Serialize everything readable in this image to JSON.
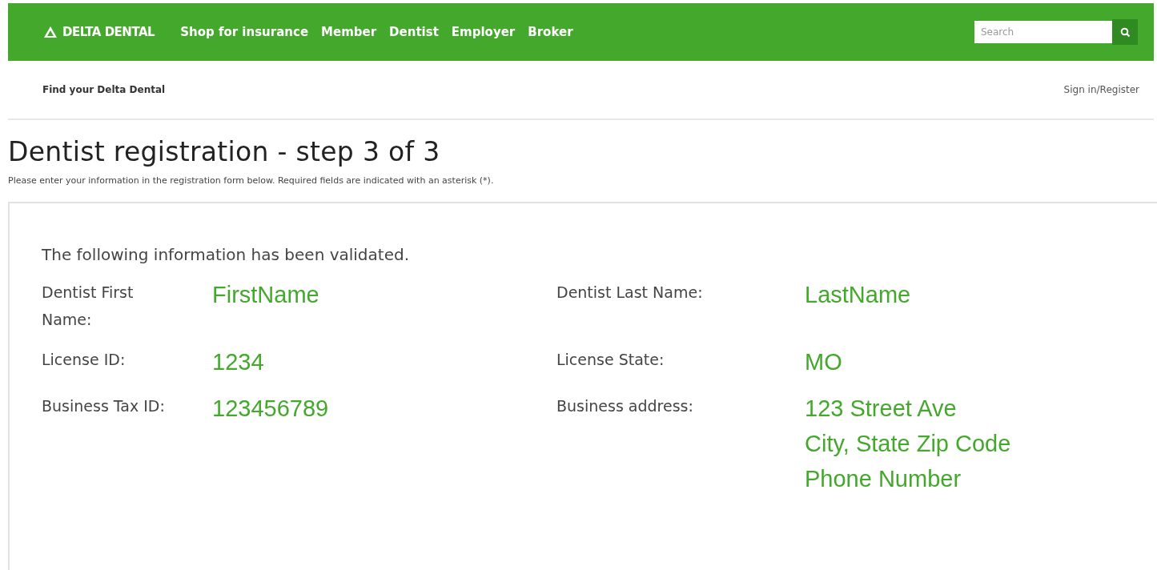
{
  "header": {
    "logo": "DELTA DENTAL",
    "nav": [
      "Shop for insurance",
      "Member",
      "Dentist",
      "Employer",
      "Broker"
    ],
    "search": {
      "placeholder": "Search"
    }
  },
  "subnav": {
    "left": "Find your Delta Dental",
    "right": "Sign in/Register"
  },
  "title": "Dentist registration - step 3 of 3",
  "intro": "Please enter your information in the registration form below. Required fields are indicated with an asterisk (*).",
  "panel": {
    "heading": "The following information has been validated.",
    "fields": [
      {
        "label": "Dentist First Name:",
        "value": [
          "FirstName"
        ]
      },
      {
        "label": "Dentist Last Name:",
        "value": [
          "LastName"
        ]
      },
      {
        "label": "License ID:",
        "value": [
          "1234"
        ]
      },
      {
        "label": "License State:",
        "value": [
          "MO"
        ]
      },
      {
        "label": "Business Tax ID:",
        "value": [
          "123456789"
        ]
      },
      {
        "label": "Business address:",
        "value": [
          "123 Street Ave",
          "City, State Zip Code",
          "Phone Number"
        ]
      }
    ]
  }
}
